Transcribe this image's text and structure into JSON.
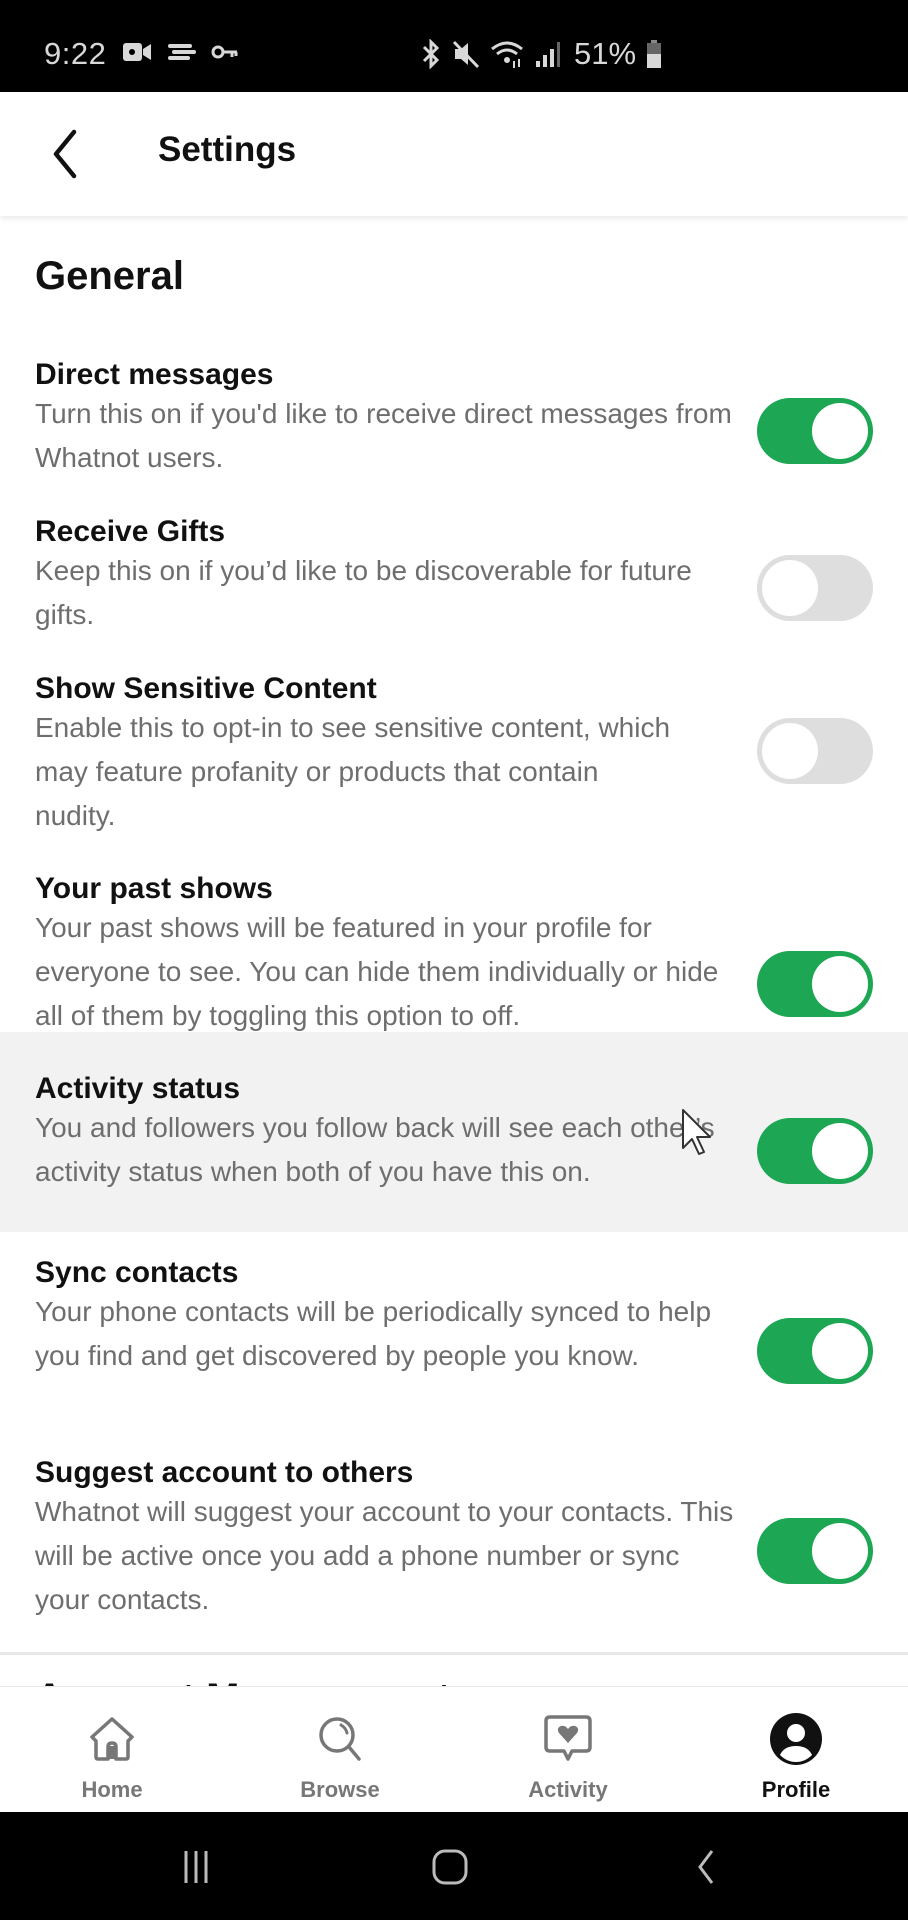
{
  "status_bar": {
    "time": "9:22",
    "battery": "51%",
    "left_icons": [
      "video-camera-icon",
      "cast-icon",
      "vpn-key-icon"
    ],
    "right_icons": [
      "bluetooth-icon",
      "mute-icon",
      "wifi-icon",
      "signal-icon",
      "battery-icon"
    ]
  },
  "header": {
    "title": "Settings",
    "back_icon": "chevron-left-icon"
  },
  "section": {
    "title": "General",
    "next_title_partial": "Account Management"
  },
  "settings": [
    {
      "title": "Direct messages",
      "description": "Turn this on if you'd like to receive direct messages from Whatnot users.",
      "enabled": true
    },
    {
      "title": "Receive Gifts",
      "description": "Keep this on if you’d like to be discoverable for future gifts.",
      "enabled": false
    },
    {
      "title": "Show Sensitive Content",
      "description": "Enable this to opt-in to see sensitive content, which may feature profanity or products that contain nudity.",
      "enabled": false
    },
    {
      "title": "Your past shows",
      "description": "Your past shows will be featured in your profile for everyone to see. You can hide them individually or hide all of them by toggling this option to off.",
      "enabled": true
    },
    {
      "title": "Activity status",
      "description": "You and followers you follow back will see each other’s activity status when both of you have this on.",
      "enabled": true
    },
    {
      "title": "Sync contacts",
      "description": "Your phone contacts will be periodically synced to help you find and get discovered by people you know.",
      "enabled": true
    },
    {
      "title": "Suggest account to others",
      "description": "Whatnot will suggest your account to your contacts. This will be active once you add a phone number or sync your contacts.",
      "enabled": true
    }
  ],
  "bottom_nav": {
    "items": [
      {
        "label": "Home",
        "icon": "home-icon",
        "active": false
      },
      {
        "label": "Browse",
        "icon": "search-icon",
        "active": false
      },
      {
        "label": "Activity",
        "icon": "activity-heart-icon",
        "active": false
      },
      {
        "label": "Profile",
        "icon": "profile-icon",
        "active": true
      }
    ]
  },
  "system_nav": [
    "recent-apps-icon",
    "home-circle-icon",
    "back-icon"
  ],
  "colors": {
    "toggle_on": "#1da653",
    "toggle_off": "#dedede",
    "highlight_row": "#f2f2f2"
  }
}
